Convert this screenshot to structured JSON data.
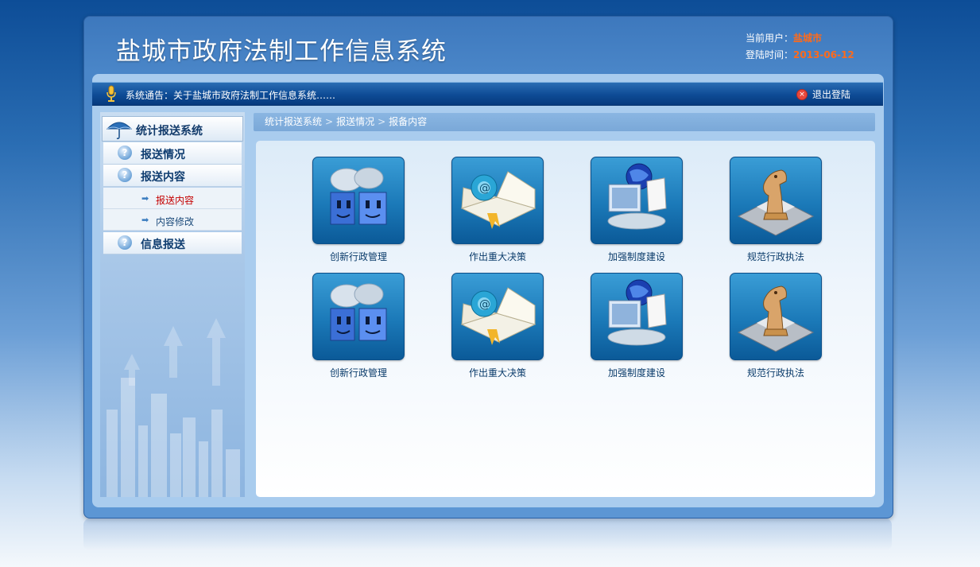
{
  "header": {
    "title": "盐城市政府法制工作信息系统",
    "user_label": "当前用户：",
    "user_value": "盐城市",
    "login_time_label": "登陆时间：",
    "login_time_value": "2013-06-12"
  },
  "notice": {
    "label": "系统通告：",
    "text": "关于盐城市政府法制工作信息系统……",
    "logout": "退出登陆"
  },
  "sidebar": {
    "title": "统计报送系统",
    "items": [
      {
        "label": "报送情况"
      },
      {
        "label": "报送内容"
      },
      {
        "label": "信息报送"
      }
    ],
    "subitems": [
      {
        "label": "报送内容",
        "active": true
      },
      {
        "label": "内容修改",
        "active": false
      }
    ]
  },
  "breadcrumb": [
    "统计报送系统",
    "报送情况",
    "报备内容"
  ],
  "tiles": [
    {
      "label": "创新行政管理",
      "icon": "faces-icon"
    },
    {
      "label": "作出重大决策",
      "icon": "book-icon"
    },
    {
      "label": "加强制度建设",
      "icon": "globe-folder-icon"
    },
    {
      "label": "规范行政执法",
      "icon": "chess-knight-icon"
    },
    {
      "label": "创新行政管理",
      "icon": "faces-icon"
    },
    {
      "label": "作出重大决策",
      "icon": "book-icon"
    },
    {
      "label": "加强制度建设",
      "icon": "globe-folder-icon"
    },
    {
      "label": "规范行政执法",
      "icon": "chess-knight-icon"
    }
  ],
  "colors": {
    "accent": "#ff6a1a",
    "frame": "#4a86c8",
    "active_sub": "#c40000"
  }
}
